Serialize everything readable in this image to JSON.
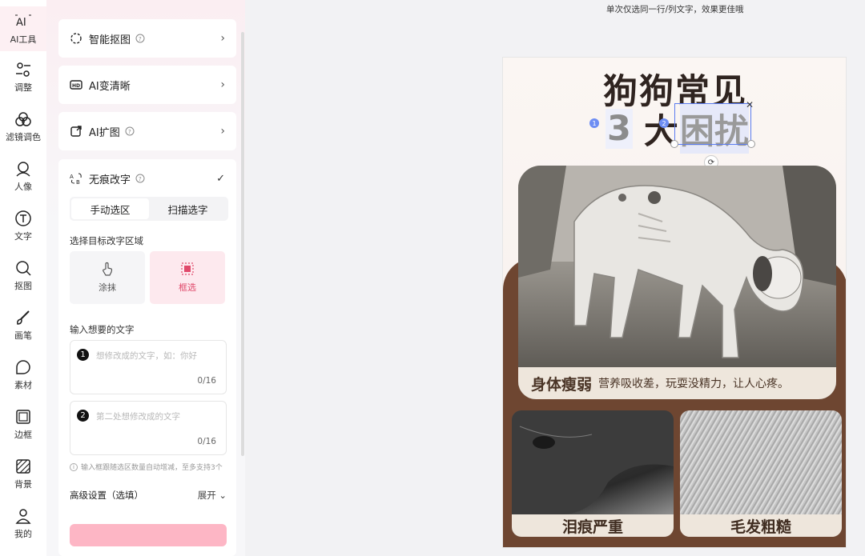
{
  "rail": [
    {
      "label": "AI工具",
      "icon": "ai-icon",
      "active": true
    },
    {
      "label": "调整",
      "icon": "adjust-icon"
    },
    {
      "label": "滤镜调色",
      "icon": "filter-icon"
    },
    {
      "label": "人像",
      "icon": "portrait-icon"
    },
    {
      "label": "文字",
      "icon": "text-icon"
    },
    {
      "label": "抠图",
      "icon": "cutout-icon"
    },
    {
      "label": "画笔",
      "icon": "brush-icon"
    },
    {
      "label": "素材",
      "icon": "sticker-icon"
    },
    {
      "label": "边框",
      "icon": "frame-icon"
    },
    {
      "label": "背景",
      "icon": "background-icon"
    },
    {
      "label": "我的",
      "icon": "user-icon"
    }
  ],
  "tools": {
    "smart_cutout": "智能抠图",
    "ai_sharpen": "AI变清晰",
    "ai_expand": "AI扩图",
    "seamless_text": "无痕改字"
  },
  "seamless": {
    "tab_manual": "手动选区",
    "tab_scan": "扫描选字",
    "select_area_label": "选择目标改字区域",
    "opt_smear": "涂抹",
    "opt_box": "框选",
    "input_label": "输入想要的文字",
    "field1_placeholder": "想修改成的文字，如：你好",
    "field1_count": "0/16",
    "field2_placeholder": "第二处想修改成的文字",
    "field2_count": "0/16",
    "hint": "输入框跟随选区数量自动增减，至多支持3个",
    "advanced_label": "高级设置（选填）",
    "advanced_toggle": "展开"
  },
  "canvas": {
    "tip": "单次仅选同一行/列文字，效果更佳哦",
    "title_line1": "狗狗常见",
    "title_num": "3",
    "title_big": "大",
    "title_kw": "困扰",
    "badge1": "1",
    "badge2": "2",
    "caption_main_bold": "身体瘦弱",
    "caption_main_text": "营养吸收差，玩耍没精力，让人心疼。",
    "caption_left": "泪痕严重",
    "caption_right": "毛发粗糙"
  },
  "colors": {
    "accent": "#e04a6b",
    "brown": "#6e4631",
    "selection": "#5b7cf0"
  }
}
